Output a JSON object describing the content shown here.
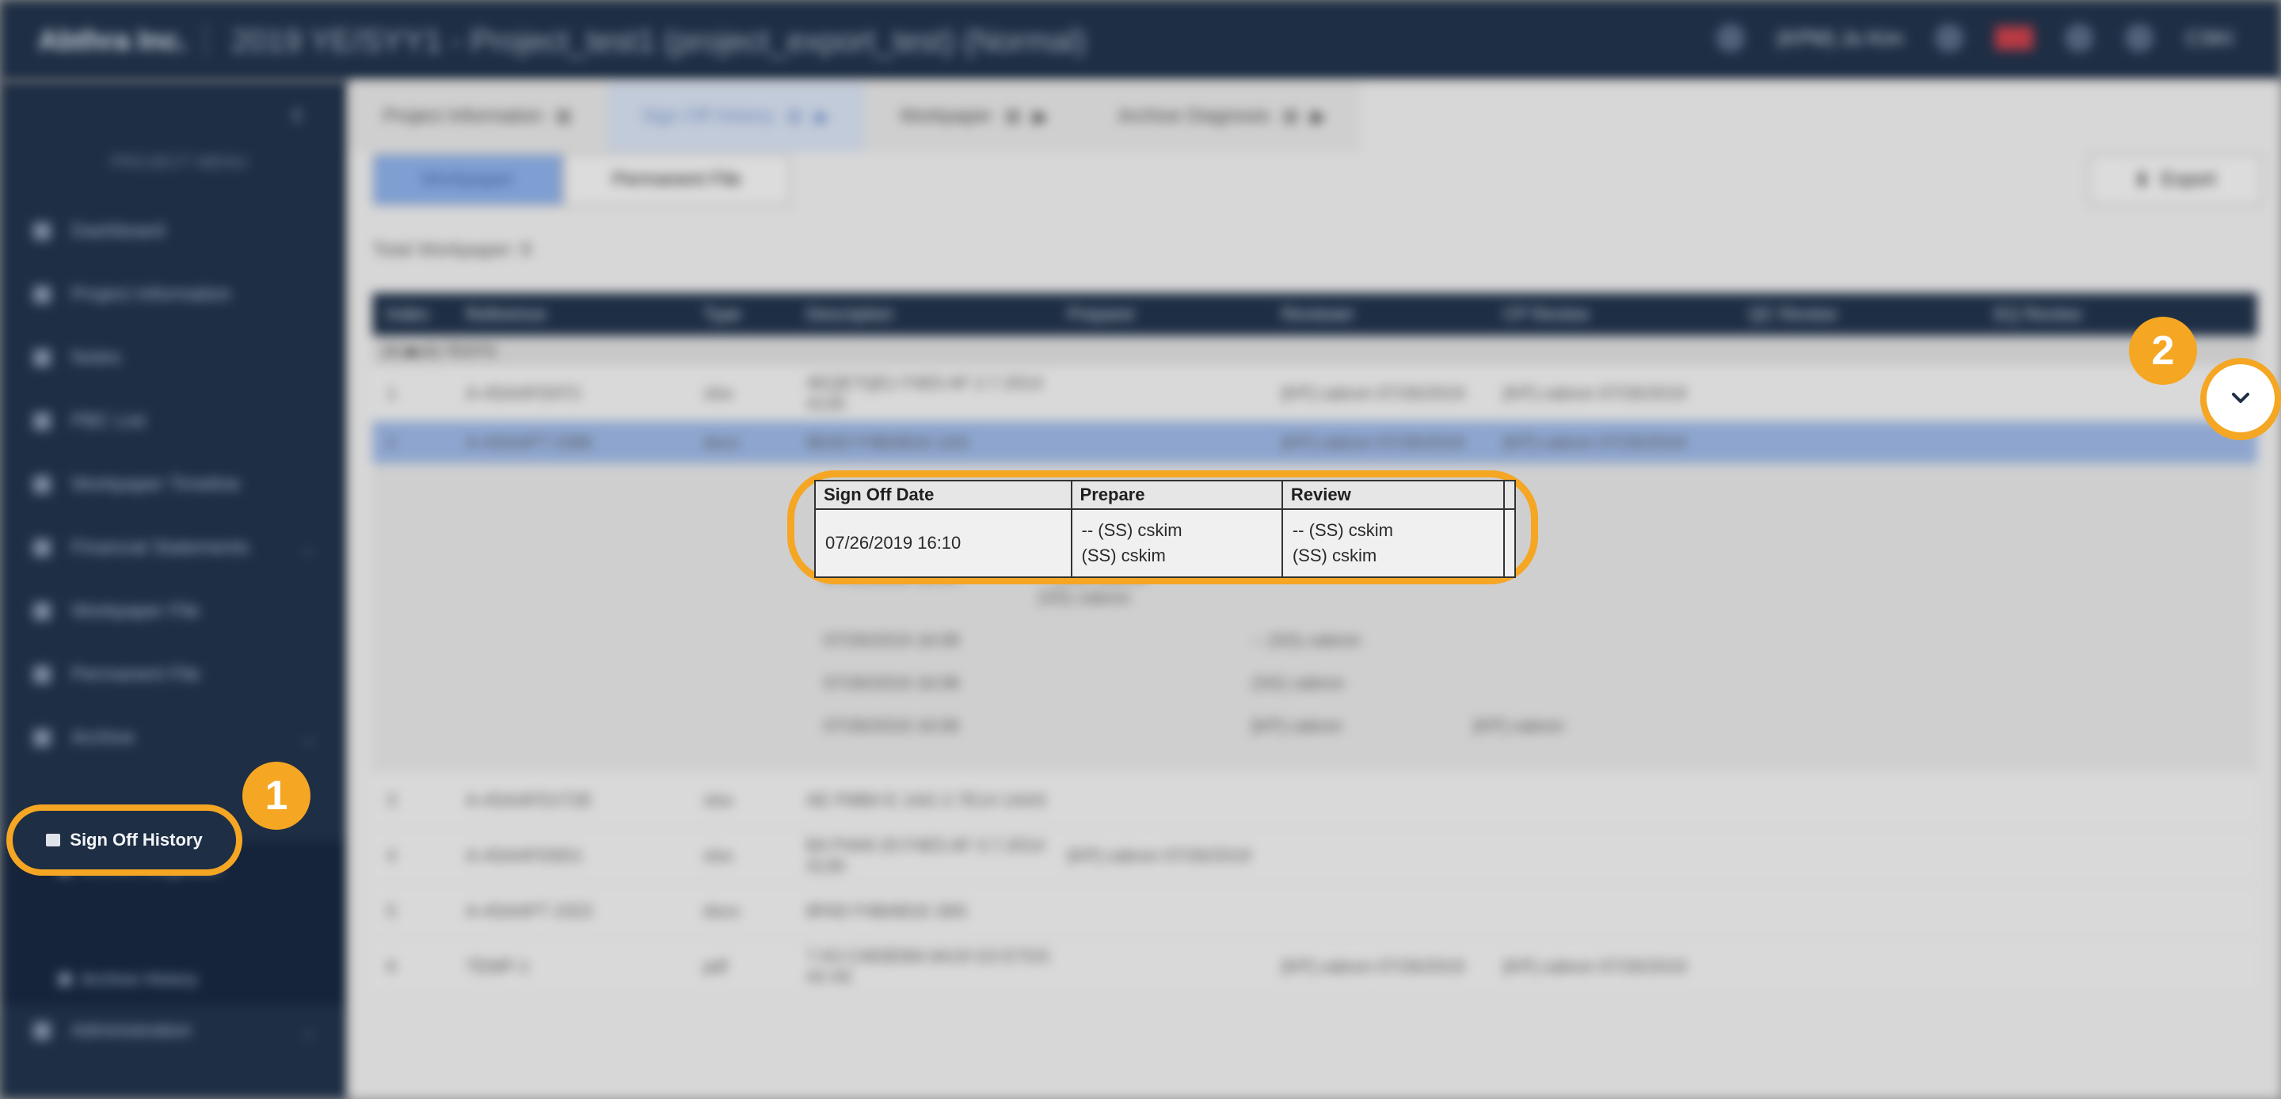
{
  "topbar": {
    "brand": "Abthra Inc.",
    "project_title": "2019 YE/SYY1 - Project_test1 (project_export_test) (Normal)",
    "user_info": "(KPM) Jo Kim",
    "account": "CSKI"
  },
  "sidebar": {
    "section_label": "PROJECT MENU",
    "items": [
      {
        "label": "Dashboard"
      },
      {
        "label": "Project Information"
      },
      {
        "label": "Notes"
      },
      {
        "label": "PBC List"
      },
      {
        "label": "Workpaper Timeline"
      },
      {
        "label": "Financial Statements"
      },
      {
        "label": "Workpaper File"
      },
      {
        "label": "Permanent File"
      },
      {
        "label": "Archive"
      }
    ],
    "sub_items": [
      {
        "label": "Archive Diagnosis"
      },
      {
        "label": "Sign Off History"
      },
      {
        "label": "Archive History"
      }
    ],
    "admin": "Administration"
  },
  "tabs": [
    {
      "label": "Project Information"
    },
    {
      "label": "Sign Off History"
    },
    {
      "label": "Workpaper"
    },
    {
      "label": "Archive Diagnosis"
    }
  ],
  "toolbar": {
    "workpaper": "Workpaper",
    "permanent": "Permanent File",
    "export": "Export"
  },
  "total_label": "Total Workpaper: 8",
  "grid": {
    "columns": [
      "Index",
      "Reference",
      "Type",
      "Description",
      "Preparer",
      "Reviewer",
      "CP Review",
      "QC Review",
      "EQ Review"
    ],
    "group_label": "(A) ▶(A) TESTS",
    "rows": [
      {
        "idx": "1",
        "ref": "A-4SAAFD0T2",
        "type": "xlsx",
        "desc": "4EQE7QE1 F4E5 AF 2.7.2014 4130",
        "prep": "",
        "rev": "[KP] cabron 07/26/2019",
        "cp": "[KP] cabron 07/26/2019"
      },
      {
        "idx": "2",
        "ref": "A-4SAAFT 2366",
        "type": "docx",
        "desc": "8EAD F4BAB16 1AS",
        "prep": "",
        "rev": "[KP] cabron 07/26/2019",
        "cp": "[KP] cabron 07/26/2019"
      },
      {
        "idx": "3",
        "ref": "A-4SAAFD1T2E",
        "type": "xlsx",
        "desc": "AE FMB4 E 1AG 2.7E14 1AAS",
        "prep": "",
        "rev": "",
        "cp": ""
      },
      {
        "idx": "4",
        "ref": "A-4SAAFD0D1",
        "type": "xlsx",
        "desc": "B4 P4A9 20 F4E5 AF 3.7.2014 4130",
        "prep": "[KP] cabron 07/26/2019",
        "rev": "",
        "cp": ""
      },
      {
        "idx": "5",
        "ref": "A-4SAAFT 2323",
        "type": "docx",
        "desc": "8FAD F4BAB16 1BS",
        "prep": "",
        "rev": "",
        "cp": ""
      },
      {
        "idx": "6",
        "ref": "TEMP-1",
        "type": "pdf",
        "desc": "7 A3 CAE8D8A 6A19 G3 E7GS 43 4S",
        "prep": "",
        "rev": "[KP] cabron 07/26/2019",
        "cp": "[KP] cabron 07/26/2019"
      }
    ],
    "history": [
      {
        "date": "07/26/2019 16:20",
        "prep": "-- (SS) cabron\n(SS) cabron",
        "rev": "",
        "cp": ""
      },
      {
        "date": "07/26/2019 16:08",
        "prep": "",
        "rev": "-- (SS) cabron",
        "cp": ""
      },
      {
        "date": "07/26/2019 16:08",
        "prep": "",
        "rev": "(SS) cabron",
        "cp": ""
      },
      {
        "date": "07/26/2019 16:06",
        "prep": "",
        "rev": "[KP] cabron",
        "cp": "[KP] cabron"
      }
    ]
  },
  "popup": {
    "headers": [
      "Sign Off Date",
      "Prepare",
      "Review",
      ""
    ],
    "date": "07/26/2019 16:10",
    "prepare_line1": "-- (SS) cskim",
    "prepare_line2": "(SS) cskim",
    "review_line1": "-- (SS) cskim",
    "review_line2": "(SS) cskim"
  },
  "active_sub": {
    "label": "Sign Off History"
  },
  "badges": {
    "one": "1",
    "two": "2"
  },
  "icons": {
    "expand": "chevron-down-icon"
  }
}
